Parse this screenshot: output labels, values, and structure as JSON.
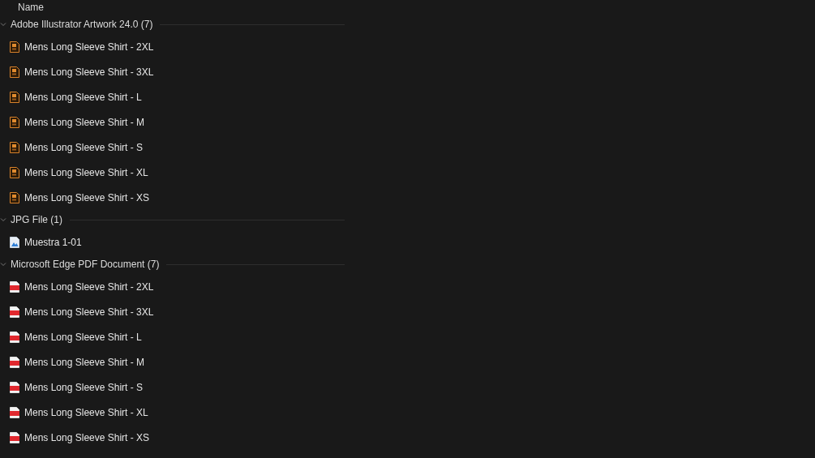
{
  "column_header": {
    "label": "Name"
  },
  "groups": [
    {
      "title": "Adobe Illustrator Artwork 24.0 (7)",
      "expanded": true,
      "items": [
        {
          "name": "Mens Long Sleeve Shirt - 2XL",
          "kind": "ai"
        },
        {
          "name": "Mens Long Sleeve Shirt - 3XL",
          "kind": "ai"
        },
        {
          "name": "Mens Long Sleeve Shirt - L",
          "kind": "ai"
        },
        {
          "name": "Mens Long Sleeve Shirt - M",
          "kind": "ai"
        },
        {
          "name": "Mens Long Sleeve Shirt - S",
          "kind": "ai"
        },
        {
          "name": "Mens Long Sleeve Shirt - XL",
          "kind": "ai"
        },
        {
          "name": "Mens Long Sleeve Shirt - XS",
          "kind": "ai"
        }
      ]
    },
    {
      "title": "JPG File (1)",
      "expanded": true,
      "items": [
        {
          "name": "Muestra 1-01",
          "kind": "jpg"
        }
      ]
    },
    {
      "title": "Microsoft Edge PDF Document (7)",
      "expanded": true,
      "items": [
        {
          "name": "Mens Long Sleeve Shirt - 2XL",
          "kind": "pdf"
        },
        {
          "name": "Mens Long Sleeve Shirt - 3XL",
          "kind": "pdf"
        },
        {
          "name": "Mens Long Sleeve Shirt - L",
          "kind": "pdf"
        },
        {
          "name": "Mens Long Sleeve Shirt - M",
          "kind": "pdf"
        },
        {
          "name": "Mens Long Sleeve Shirt - S",
          "kind": "pdf"
        },
        {
          "name": "Mens Long Sleeve Shirt - XL",
          "kind": "pdf"
        },
        {
          "name": "Mens Long Sleeve Shirt - XS",
          "kind": "pdf"
        }
      ]
    }
  ]
}
